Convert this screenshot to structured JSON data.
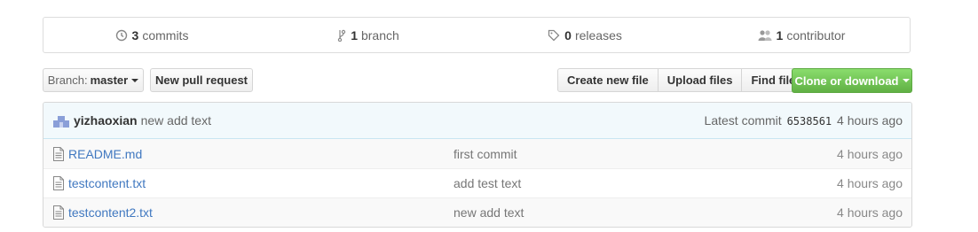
{
  "summary": {
    "commits": {
      "count": "3",
      "label": "commits",
      "icon": "history-icon"
    },
    "branches": {
      "count": "1",
      "label": "branch",
      "icon": "git-branch-icon"
    },
    "releases": {
      "count": "0",
      "label": "releases",
      "icon": "tag-icon"
    },
    "contributors": {
      "count": "1",
      "label": "contributor",
      "icon": "organization-icon"
    }
  },
  "toolbar": {
    "branch_prefix": "Branch:",
    "branch_name": "master",
    "new_pull_request": "New pull request",
    "create_new_file": "Create new file",
    "upload_files": "Upload files",
    "find_file": "Find file",
    "clone_or_download": "Clone or download"
  },
  "latest_commit": {
    "author": "yizhaoxian",
    "message": "new add text",
    "label": "Latest commit",
    "sha": "6538561",
    "age": "4 hours ago"
  },
  "files": [
    {
      "name": "README.md",
      "message": "first commit",
      "age": "4 hours ago"
    },
    {
      "name": "testcontent.txt",
      "message": "add test text",
      "age": "4 hours ago"
    },
    {
      "name": "testcontent2.txt",
      "message": "new add text",
      "age": "4 hours ago"
    }
  ],
  "colors": {
    "link": "#4078c0",
    "clone_green": "#6cc644",
    "commit_bg": "#f2f9fc"
  }
}
